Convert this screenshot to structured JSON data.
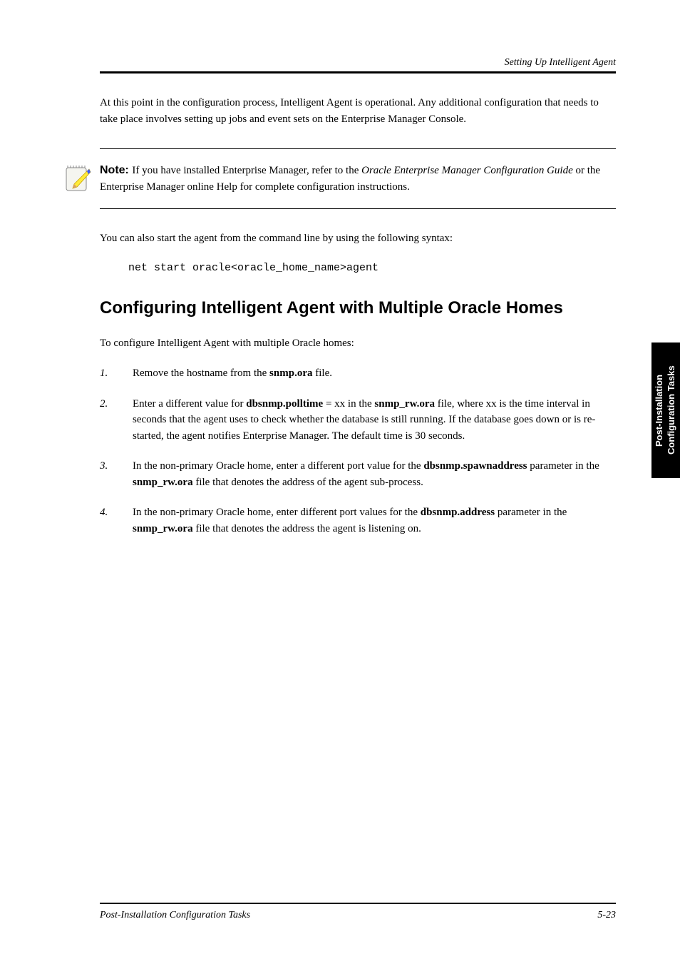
{
  "header": {
    "breadcrumb": "Setting Up Intelligent Agent"
  },
  "body": {
    "p1": "At this point in the configuration process, Intelligent Agent is operational. Any additional configuration that needs to take place involves setting up jobs and event sets on the Enterprise Manager Console.",
    "p2": "You can also start the agent from the command line by using the following syntax:"
  },
  "note": {
    "label": "Note: ",
    "text_before": "If you have installed Enterprise Manager, refer to the ",
    "italic1": "Oracle Enterprise Manager Configuration Guide",
    "text_mid": " or the Enterprise Manager online Help for complete configuration instructions.",
    "additional": ""
  },
  "code": {
    "line": "net start oracle<oracle_home_name>agent"
  },
  "section": {
    "heading": "Configuring Intelligent Agent with Multiple Oracle Homes",
    "intro": "To configure Intelligent Agent with multiple Oracle homes:",
    "steps": [
      {
        "n": "1.",
        "body_plain": "",
        "body": [
          {
            "t": "Remove the hostname from the ",
            "bold": false
          },
          {
            "t": "snmp.ora",
            "bold": true
          },
          {
            "t": " file.",
            "bold": false
          }
        ]
      },
      {
        "n": "2.",
        "body": [
          {
            "t": "Enter a different value for ",
            "bold": false
          },
          {
            "t": "dbsnmp.polltime ",
            "bold": true
          },
          {
            "t": "= xx in the ",
            "bold": false
          },
          {
            "t": "snmp_rw.ora",
            "bold": true
          },
          {
            "t": " file, where xx is the time interval in seconds that the agent uses to check whether the database is still running. If the database goes down or is re-started, the agent notifies Enterprise Manager. The default time is 30 seconds.",
            "bold": false
          }
        ]
      },
      {
        "n": "3.",
        "body": [
          {
            "t": "In the non-primary Oracle home, enter a different port value for the ",
            "bold": false
          },
          {
            "t": "dbsnmp.spawnaddress",
            "bold": true
          },
          {
            "t": " parameter in the ",
            "bold": false
          },
          {
            "t": "snmp_rw.ora",
            "bold": true
          },
          {
            "t": " file that denotes the address of the agent sub-process.",
            "bold": false
          }
        ]
      },
      {
        "n": "4.",
        "body": [
          {
            "t": "In the non-primary Oracle home, enter different port values for the ",
            "bold": false
          },
          {
            "t": "dbsnmp.address",
            "bold": true
          },
          {
            "t": " parameter in the ",
            "bold": false
          },
          {
            "t": "snmp_rw.ora",
            "bold": true
          },
          {
            "t": " file that denotes the address the agent is listening on.",
            "bold": false
          }
        ]
      }
    ]
  },
  "sidetab": {
    "text": "Post-Installation Configuration Tasks"
  },
  "footer": {
    "left": "Post-Installation Configuration Tasks",
    "right": "5-23"
  }
}
